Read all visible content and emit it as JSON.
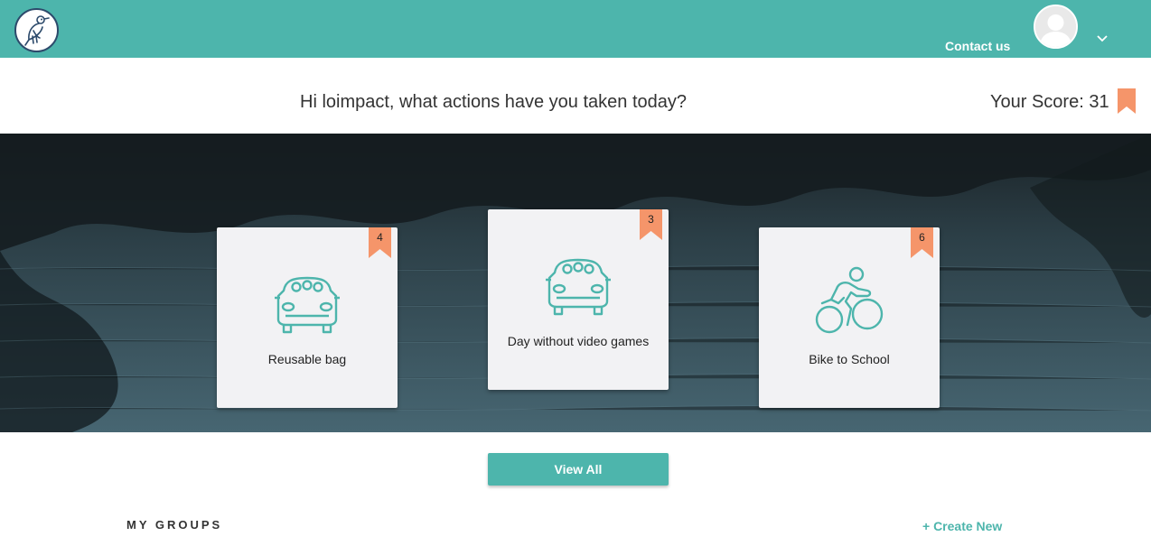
{
  "header": {
    "contact_label": "Contact us",
    "brand_color": "#4db5ac",
    "icons": [
      "bird-logo-icon",
      "avatar-icon",
      "chevron-down-icon"
    ]
  },
  "greeting": {
    "text": "Hi loimpact, what actions have you taken today?",
    "score_label": "Your Score: 31",
    "score_value": 31
  },
  "actions": [
    {
      "label": "Reusable bag",
      "points": "4",
      "icon": "car-icon"
    },
    {
      "label": "Day without video games",
      "points": "3",
      "icon": "car-icon"
    },
    {
      "label": "Bike to School",
      "points": "6",
      "icon": "bicycle-icon"
    }
  ],
  "ribbon_color": "#f5956a",
  "view_all_label": "View All",
  "groups": {
    "title": "MY GROUPS",
    "create_label": "+ Create New"
  }
}
